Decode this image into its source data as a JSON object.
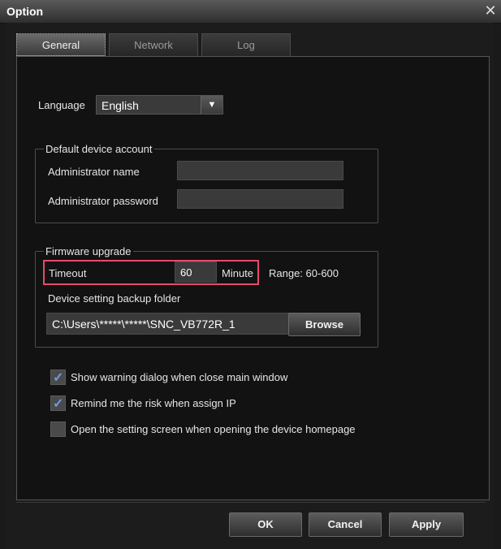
{
  "window": {
    "title": "Option",
    "close_symbol": "✕"
  },
  "tabs": [
    {
      "label": "General",
      "active": true
    },
    {
      "label": "Network",
      "active": false
    },
    {
      "label": "Log",
      "active": false
    }
  ],
  "language": {
    "label": "Language",
    "value": "English"
  },
  "account": {
    "legend": "Default device account",
    "admin_name_label": "Administrator name",
    "admin_name_value": "",
    "admin_password_label": "Administrator password",
    "admin_password_value": ""
  },
  "firmware": {
    "legend": "Firmware upgrade",
    "timeout_label": "Timeout",
    "timeout_value": "60",
    "unit": "Minute",
    "range": "Range: 60-600",
    "backup_label": "Device setting backup folder",
    "backup_path": "C:\\Users\\*****\\*****\\SNC_VB772R_1",
    "browse_label": "Browse"
  },
  "options": [
    {
      "label": "Show warning dialog when close main window",
      "checked": true
    },
    {
      "label": "Remind me the risk when assign IP",
      "checked": true
    },
    {
      "label": "Open the setting screen when opening the device homepage",
      "checked": false
    }
  ],
  "buttons": {
    "ok": "OK",
    "cancel": "Cancel",
    "apply": "Apply"
  },
  "colors": {
    "accent_check": "#6e9be0",
    "highlight_border": "#e84a6a"
  }
}
